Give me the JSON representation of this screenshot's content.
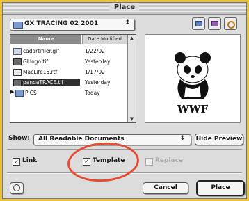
{
  "window": {
    "title": "Place"
  },
  "folder_popup": {
    "label": "GX TRACING 02 2001",
    "arrow": "↕"
  },
  "toolbar_buttons": [
    "disk-icon",
    "folder-icon",
    "recent-icon"
  ],
  "file_list": {
    "headers": {
      "name": "Name",
      "date": "Date Modified"
    },
    "rows": [
      {
        "name": "cadartifiler.gif",
        "date": "1/22/02",
        "icon": "gif-file-icon"
      },
      {
        "name": "GLlogo.tif",
        "date": "Yesterday",
        "icon": "tif-file-icon"
      },
      {
        "name": "MacLife15.rtf",
        "date": "1/17/02",
        "icon": "rtf-file-icon"
      },
      {
        "name": "pandaTRACE.tif",
        "date": "Yesterday",
        "icon": "tif-file-icon",
        "selected": true
      },
      {
        "name": "PICS",
        "date": "Today",
        "icon": "folder-icon"
      }
    ]
  },
  "preview": {
    "logo_text": "WWF"
  },
  "show": {
    "label": "Show:",
    "value": "All Readable Documents",
    "arrow": "↕"
  },
  "hide_preview_label": "Hide Preview",
  "options": {
    "link": {
      "label": "Link",
      "checked": true
    },
    "template": {
      "label": "Template",
      "checked": true
    },
    "replace": {
      "label": "Replace",
      "checked": false,
      "disabled": true
    }
  },
  "buttons": {
    "cancel": "Cancel",
    "place": "Place"
  },
  "colors": {
    "background": "#f4d24a",
    "highlight_circle": "#e64b32",
    "selection": "#2f2f2f"
  }
}
